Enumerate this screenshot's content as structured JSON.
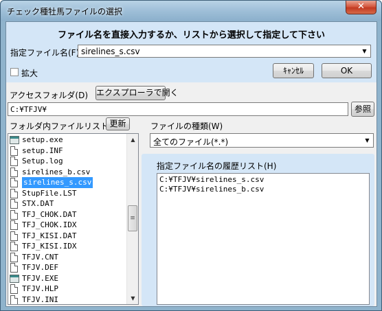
{
  "window": {
    "title": "チェック種牡馬ファイルの選択",
    "close_glyph": "✕"
  },
  "header": {
    "instruction": "ファイル名を直接入力するか、リストから選択して指定して下さい",
    "filename_label": "指定ファイル名(F)",
    "filename_value": "sirelines_s.csv",
    "enlarge_label": "拡大",
    "enlarge_checked": false,
    "cancel_label": "ｷｬﾝｾﾙ",
    "ok_label": "OK"
  },
  "folder": {
    "access_label": "アクセスフォルダ(D)",
    "explorer_button": "エクスプローラで開く",
    "path": "C:¥TFJV¥",
    "browse_button": "参照"
  },
  "file_list": {
    "label": "フォルダ内ファイルリスト(L)",
    "refresh_button": "更新",
    "items": [
      {
        "name": "setup.exe",
        "icon": "app-icon"
      },
      {
        "name": "setup.INF",
        "icon": "document-icon"
      },
      {
        "name": "Setup.log",
        "icon": "document-icon"
      },
      {
        "name": "sirelines_b.csv",
        "icon": "document-icon"
      },
      {
        "name": "sirelines_s.csv",
        "icon": "document-icon",
        "selected": true
      },
      {
        "name": "StupFile.LST",
        "icon": "document-icon"
      },
      {
        "name": "STX.DAT",
        "icon": "document-icon"
      },
      {
        "name": "TFJ_CHOK.DAT",
        "icon": "document-icon"
      },
      {
        "name": "TFJ_CHOK.IDX",
        "icon": "document-icon"
      },
      {
        "name": "TFJ_KISI.DAT",
        "icon": "document-icon"
      },
      {
        "name": "TFJ_KISI.IDX",
        "icon": "document-icon"
      },
      {
        "name": "TFJV.CNT",
        "icon": "document-icon"
      },
      {
        "name": "TFJV.DEF",
        "icon": "document-icon"
      },
      {
        "name": "TFJV.EXE",
        "icon": "app-icon"
      },
      {
        "name": "TFJV.HLP",
        "icon": "document-icon"
      },
      {
        "name": "TFJV.INI",
        "icon": "document-icon"
      }
    ]
  },
  "file_type": {
    "label": "ファイルの種類(W)",
    "selected": "全てのファイル(*.*)"
  },
  "history": {
    "label": "指定ファイル名の履歴リスト(H)",
    "items": [
      "C:¥TFJV¥sirelines_s.csv",
      "C:¥TFJV¥sirelines_b.csv"
    ]
  },
  "colors": {
    "header_panel": "#d4e6f7",
    "selection": "#3399ff",
    "close_button": "#c23a22"
  }
}
